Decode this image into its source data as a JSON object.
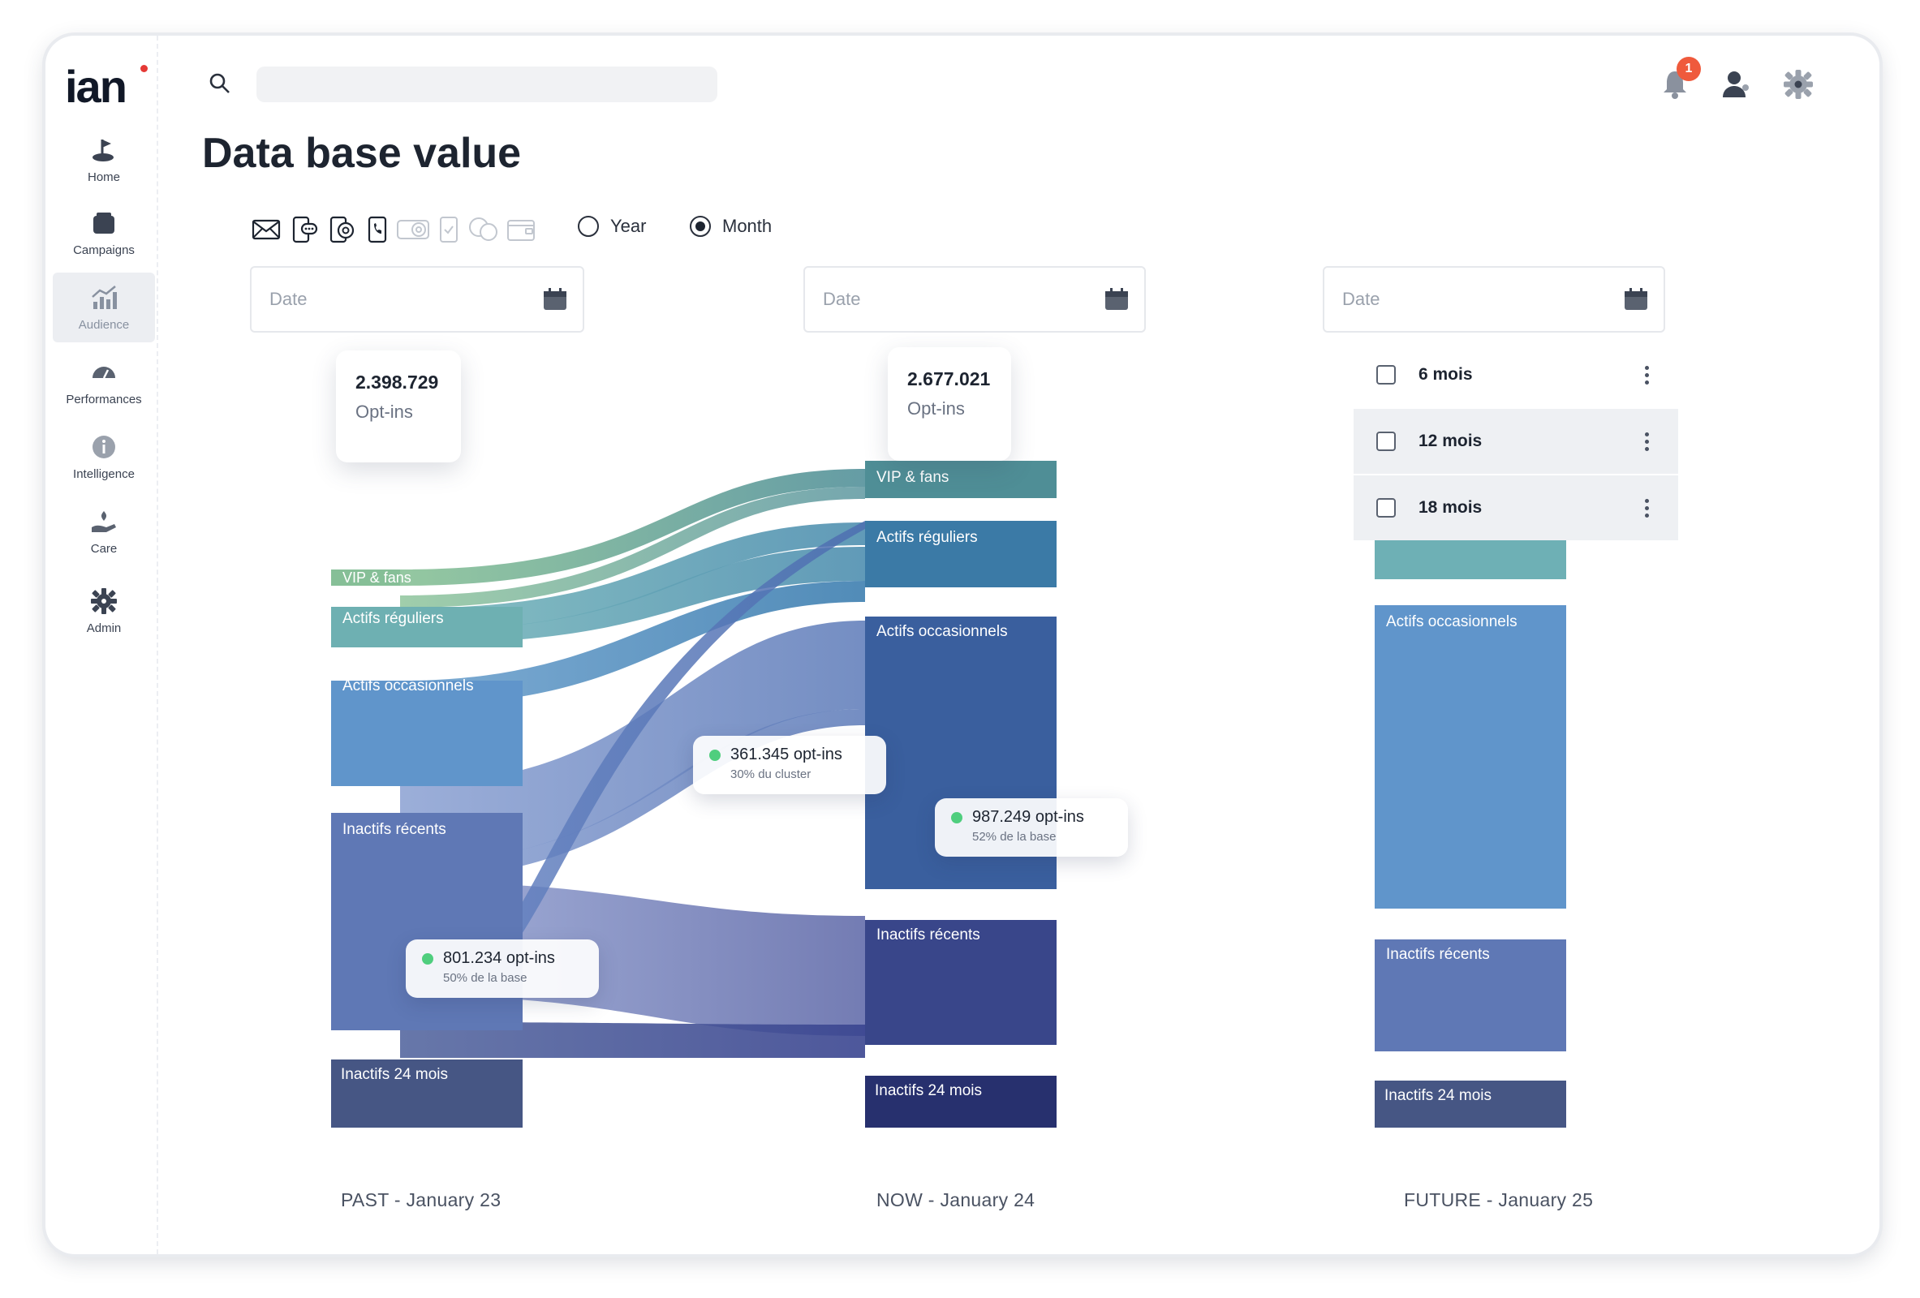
{
  "app": {
    "logo": "ian"
  },
  "sidebar": {
    "items": [
      {
        "label": "Home",
        "icon": "flag-icon"
      },
      {
        "label": "Campaigns",
        "icon": "campaigns-icon"
      },
      {
        "label": "Audience",
        "icon": "audience-icon",
        "active": true
      },
      {
        "label": "Performances",
        "icon": "gauge-icon"
      },
      {
        "label": "Intelligence",
        "icon": "info-icon"
      },
      {
        "label": "Care",
        "icon": "care-hand-icon"
      },
      {
        "label": "Admin",
        "icon": "gear-icon"
      }
    ]
  },
  "header": {
    "search_placeholder": "",
    "notification_count": "1"
  },
  "page": {
    "title": "Data base value"
  },
  "channels": [
    "email-icon",
    "sms-chat-icon",
    "mobile-at-icon",
    "mobile-phone-icon",
    "coin-icon",
    "phone-check-icon",
    "chat-bubbles-icon",
    "wallet-icon"
  ],
  "period": {
    "options": [
      "Year",
      "Month"
    ],
    "selected": "Month"
  },
  "date_fields": [
    {
      "placeholder": "Date"
    },
    {
      "placeholder": "Date"
    },
    {
      "placeholder": "Date"
    }
  ],
  "tooltips": {
    "past_total": {
      "value": "2.398.729",
      "label": "Opt-ins"
    },
    "now_total": {
      "value": "2.677.021",
      "label": "Opt-ins"
    }
  },
  "stat_bubbles": [
    {
      "value": "361.345 opt-ins",
      "sub": "30% du cluster"
    },
    {
      "value": "987.249 opt-ins",
      "sub": "52% de la base"
    },
    {
      "value": "801.234 opt-ins",
      "sub": "50% de la base"
    }
  ],
  "future_menu": [
    {
      "label": "6 mois"
    },
    {
      "label": "12 mois"
    },
    {
      "label": "18 mois"
    }
  ],
  "chart_data": {
    "type": "sankey",
    "columns": [
      "PAST - January 23",
      "NOW - January 24",
      "FUTURE - January 25"
    ],
    "segments": [
      "VIP & fans",
      "Actifs réguliers",
      "Actifs occasionnels",
      "Inactifs récents",
      "Inactifs 24 mois"
    ],
    "past_labels": [
      "VIP & fans",
      "Actifs réguliers",
      "Actifs occasionnels",
      "Inactifs récents",
      "Inactifs 24 mois"
    ],
    "now_labels": [
      "VIP & fans",
      "Actifs réguliers",
      "Actifs occasionnels",
      "Inactifs récents",
      "Inactifs 24 mois"
    ],
    "future_labels": [
      "Actifs occasionnels",
      "Inactifs récents",
      "Inactifs 24 mois"
    ],
    "colors": {
      "vip_past": "#86bf97",
      "vip_now": "#4f8e96",
      "reguliers_past": "#6eb0b2",
      "reguliers_now": "#3b7aa6",
      "occasionnels_past": "#6095cb",
      "occasionnels_now": "#3a5f9e",
      "inactifs_recents_past": "#5f78b5",
      "inactifs_recents_now": "#39468a",
      "inactifs_24_past": "#465684",
      "inactifs_24_now": "#27306e"
    }
  }
}
